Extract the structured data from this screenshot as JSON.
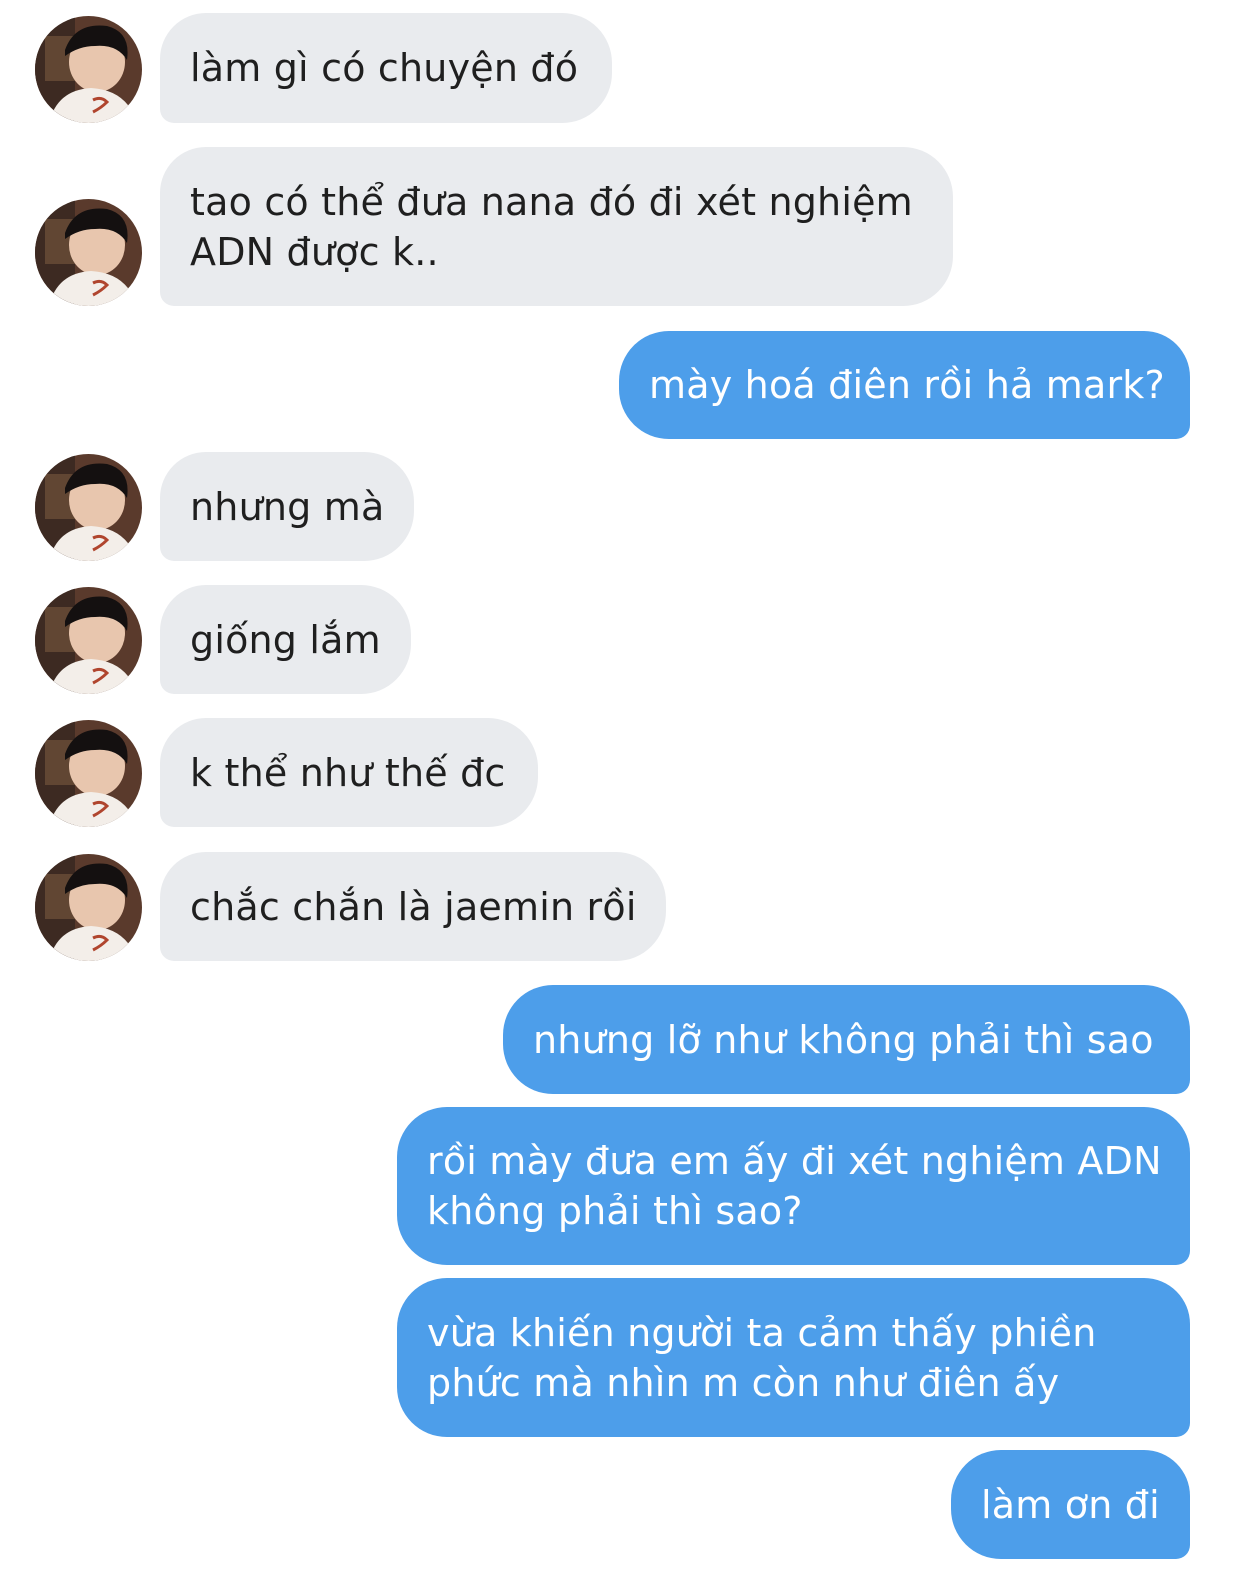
{
  "conversation": {
    "messages": [
      {
        "side": "in",
        "lines": [
          "làm gì có chuyện đó"
        ]
      },
      {
        "side": "in",
        "lines": [
          "tao có thể đưa nana đó đi xét nghiệm",
          "ADN được k.."
        ]
      },
      {
        "side": "out",
        "lines": [
          "mày hoá điên rồi hả mark?"
        ]
      },
      {
        "side": "in",
        "lines": [
          "nhưng mà"
        ]
      },
      {
        "side": "in",
        "lines": [
          "giống lắm"
        ]
      },
      {
        "side": "in",
        "lines": [
          "k thể như thế đc"
        ]
      },
      {
        "side": "in",
        "lines": [
          "chắc chắn là jaemin rồi"
        ]
      },
      {
        "side": "out",
        "lines": [
          "nhưng lỡ như không phải thì sao"
        ]
      },
      {
        "side": "out",
        "lines": [
          "rồi mày đưa em ấy đi xét nghiệm ADN",
          "không phải thì sao?"
        ]
      },
      {
        "side": "out",
        "lines": [
          "vừa khiến người ta cảm thấy phiền",
          "phức mà nhìn m còn như điên ấy"
        ]
      },
      {
        "side": "out",
        "lines": [
          "làm ơn đi"
        ]
      }
    ]
  },
  "contact": {
    "avatar_icon": "contact-avatar-photo"
  },
  "colors": {
    "incoming_bubble": "#e9ebee",
    "incoming_text": "#1f1f1f",
    "outgoing_bubble": "#4d9eea",
    "outgoing_text": "#ffffff",
    "background": "#ffffff"
  }
}
